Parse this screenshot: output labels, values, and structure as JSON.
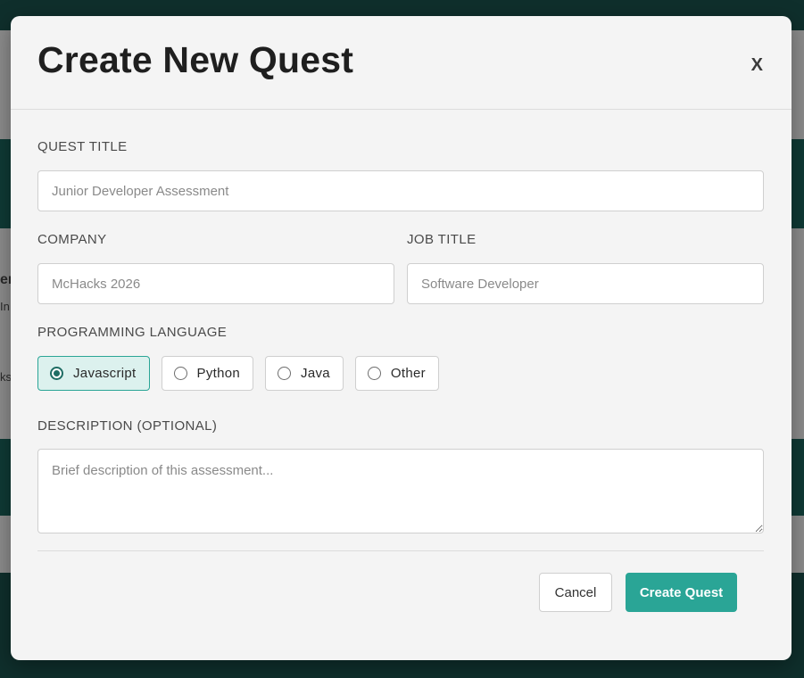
{
  "modal": {
    "title": "Create New Quest",
    "close_label": "X"
  },
  "form": {
    "quest_title": {
      "label": "QUEST TITLE",
      "placeholder": "Junior Developer Assessment"
    },
    "company": {
      "label": "COMPANY",
      "placeholder": "McHacks 2026"
    },
    "job_title": {
      "label": "JOB TITLE",
      "placeholder": "Software Developer"
    },
    "programming_language": {
      "label": "PROGRAMMING LANGUAGE",
      "selected": "Javascript",
      "options": [
        {
          "label": "Javascript",
          "selected": true
        },
        {
          "label": "Python",
          "selected": false
        },
        {
          "label": "Java",
          "selected": false
        },
        {
          "label": "Other",
          "selected": false
        }
      ]
    },
    "description": {
      "label": "DESCRIPTION (OPTIONAL)",
      "placeholder": "Brief description of this assessment..."
    }
  },
  "actions": {
    "cancel_label": "Cancel",
    "create_label": "Create Quest"
  },
  "background": {
    "fragments": [
      "en",
      "In",
      "ks"
    ]
  },
  "colors": {
    "accent": "#2aa596",
    "accent_dark": "#1f6d64",
    "selected_bg": "#dcf1ee",
    "overlay_dark": "#0f2f2c"
  }
}
